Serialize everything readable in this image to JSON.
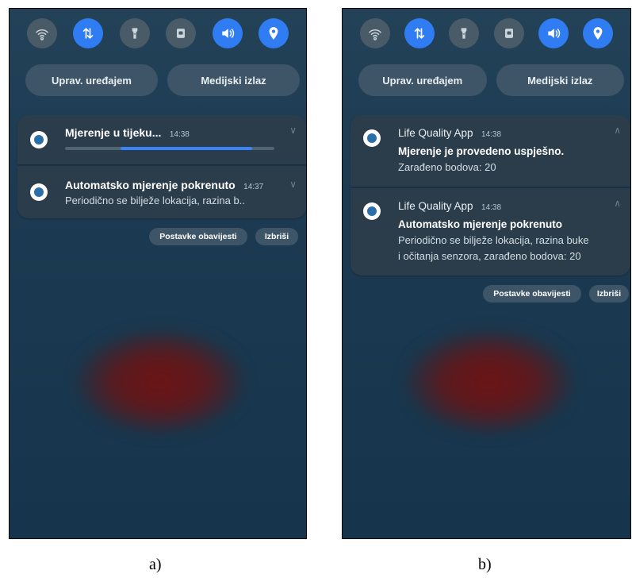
{
  "panels": [
    {
      "caption": "a)",
      "quick_settings": [
        "wifi-icon",
        "data-sync-icon",
        "flashlight-icon",
        "screen-lock-icon",
        "volume-icon",
        "location-icon"
      ],
      "device_control": "Uprav. uređajem",
      "media_output": "Medijski izlaz",
      "notif1": {
        "title": "Mjerenje u tijeku...",
        "time": "14:38",
        "progress": 0.65
      },
      "notif2": {
        "title": "Automatsko mjerenje pokrenuto",
        "time": "14:37",
        "text": "Periodično se bilježe lokacija, razina b.."
      },
      "actions": {
        "settings": "Postavke obavijesti",
        "clear": "Izbriši"
      }
    },
    {
      "caption": "b)",
      "quick_settings": [
        "wifi-icon",
        "data-sync-icon",
        "flashlight-icon",
        "screen-lock-icon",
        "volume-icon",
        "location-icon"
      ],
      "device_control": "Uprav. uređajem",
      "media_output": "Medijski izlaz",
      "notif1": {
        "app": "Life Quality App",
        "time": "14:38",
        "title": "Mjerenje je provedeno uspješno.",
        "text": "Zarađeno bodova: 20"
      },
      "notif2": {
        "app": "Life Quality App",
        "time": "14:38",
        "title": "Automatsko mjerenje pokrenuto",
        "text1": "Periodično se bilježe lokacija, razina buke",
        "text2": "i očitanja senzora, zarađeno bodova: 20"
      },
      "actions": {
        "settings": "Postavke obavijesti",
        "clear": "Izbriši"
      }
    }
  ],
  "colors": {
    "accent": "#2f7cf3",
    "progress": "#3a84f5"
  }
}
